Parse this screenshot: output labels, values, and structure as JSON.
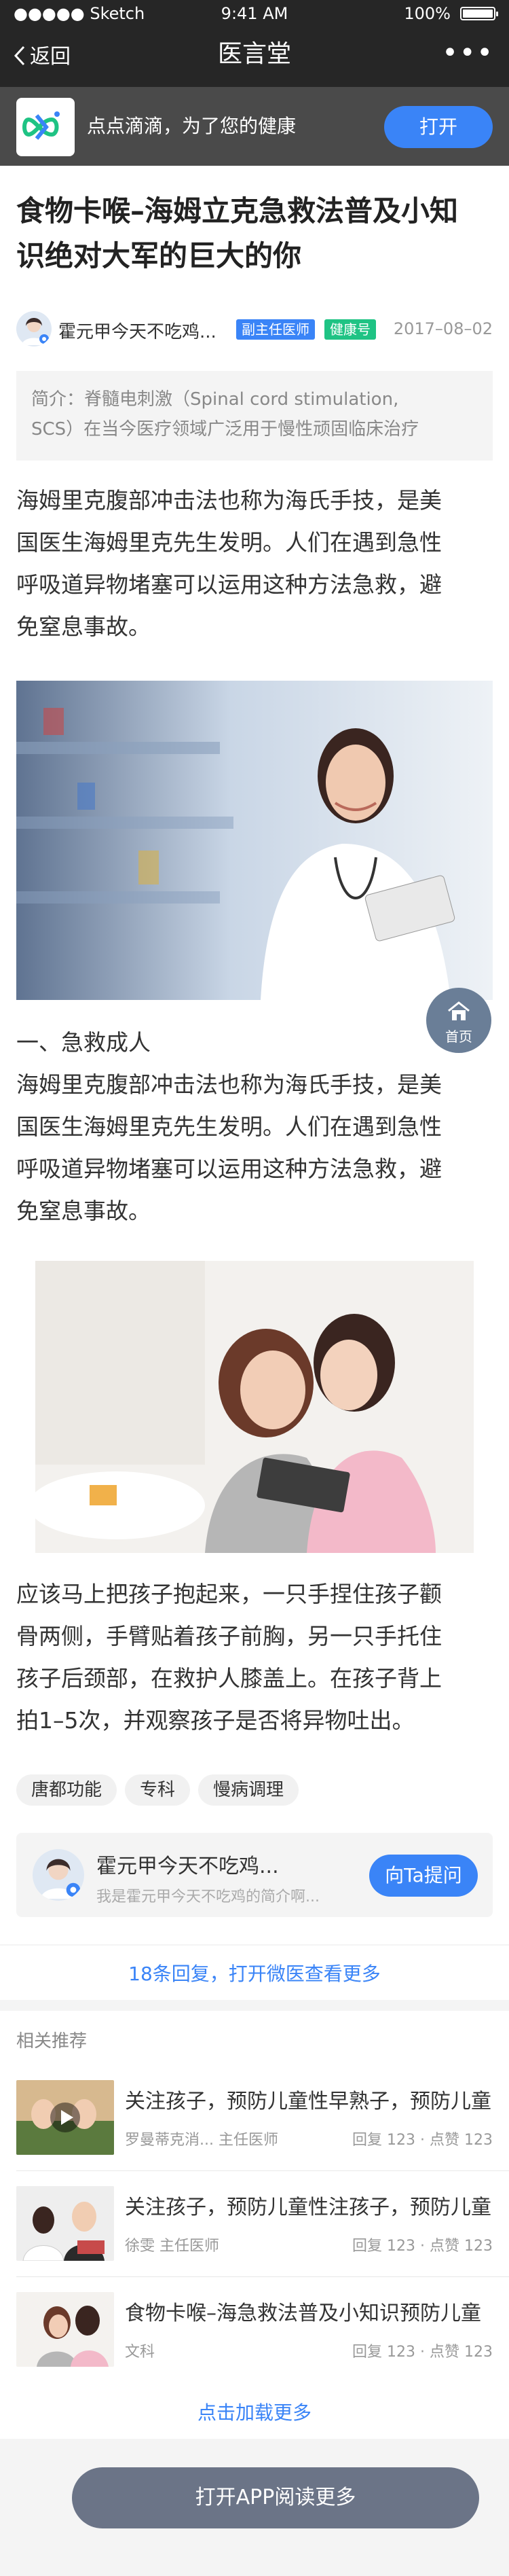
{
  "status_bar": {
    "carrier": "●●●●● Sketch",
    "time": "9:41 AM",
    "battery": "100%"
  },
  "nav": {
    "back_label": "返回",
    "title": "医言堂",
    "more": "•••"
  },
  "app_banner": {
    "text": "点点滴滴，为了您的健康",
    "open_label": "打开"
  },
  "article": {
    "title_lines": [
      "食物卡喉–海姆立克急救法普及小知",
      "识绝对大军的巨大的你"
    ],
    "author": "霍元甲今天不吃鸡...",
    "badge_title": "副主任医师",
    "badge_type": "健康号",
    "date": "2017–08–02",
    "summary_lines": [
      "简介：脊髓电刺激（Spinal cord stimulation,",
      "SCS）在当今医疗领域广泛用于慢性顽固临床治疗"
    ],
    "para1_lines": [
      "海姆里克腹部冲击法也称为海氏手技，是美",
      "国医生海姆里克先生发明。人们在遇到急性",
      "呼吸道异物堵塞可以运用这种方法急救，避",
      "免窒息事故。"
    ],
    "heading1": "一、急救成人",
    "para2_lines": [
      "海姆里克腹部冲击法也称为海氏手技，是美",
      "国医生海姆里克先生发明。人们在遇到急性",
      "呼吸道异物堵塞可以运用这种方法急救，避",
      "免窒息事故。"
    ],
    "para3_lines": [
      "应该马上把孩子抱起来，一只手捏住孩子颧",
      "骨两侧，手臂贴着孩子前胸，另一只手托住",
      "孩子后颈部，在救护人膝盖上。在孩子背上",
      "拍1–5次，并观察孩子是否将异物吐出。"
    ],
    "tags": [
      "唐都功能",
      "专科",
      "慢病调理"
    ]
  },
  "home_button": {
    "label": "首页"
  },
  "ask_card": {
    "name": "霍元甲今天不吃鸡...",
    "sub": "我是霍元甲今天不吃鸡的简介啊...",
    "button": "向Ta提问"
  },
  "replies_link": "18条回复，打开微医查看更多",
  "recommend": {
    "section_title": "相关推荐",
    "items": [
      {
        "title": "关注孩子，预防儿童性早熟子，预防儿童",
        "author": "罗曼蒂克消...  主任医师",
        "stats": "回复 123 · 点赞 123"
      },
      {
        "title": "关注孩子，预防儿童性注孩子，预防儿童",
        "author": "徐雯  主任医师",
        "stats": "回复 123 · 点赞 123"
      },
      {
        "title": "食物卡喉–海急救法普及小知识预防儿童",
        "author": "文科",
        "stats": "回复 123 · 点赞 123"
      }
    ],
    "load_more": "点击加载更多"
  },
  "open_app": "打开APP阅读更多",
  "colors": {
    "accent": "#3a84f7",
    "green": "#1fc384",
    "dark_bar": "#262626"
  }
}
